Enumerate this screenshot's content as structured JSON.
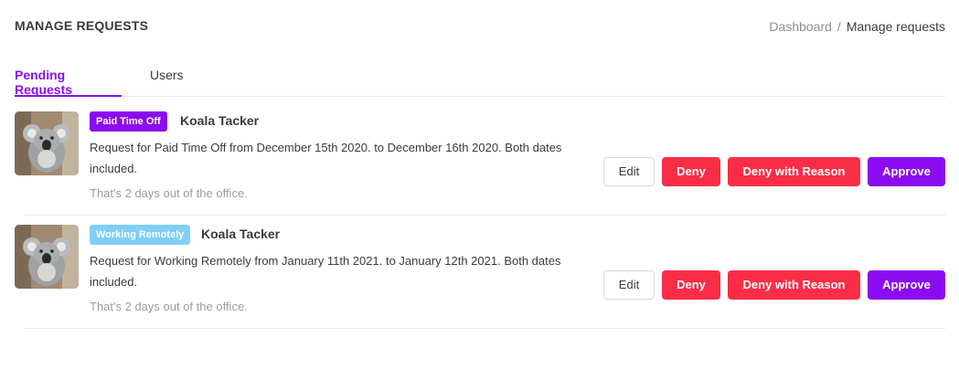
{
  "header": {
    "title": "MANAGE REQUESTS",
    "breadcrumb": {
      "link": "Dashboard",
      "separator": "/",
      "current": "Manage requests"
    }
  },
  "tabs": [
    {
      "label": "Pending Requests",
      "active": true
    },
    {
      "label": "Users",
      "active": false
    }
  ],
  "requests": [
    {
      "badge": "Paid Time Off",
      "badge_color": "#8b0cf0",
      "name": "Koala Tacker",
      "description": "Request for Paid Time Off from December 15th 2020. to December 16th 2020. Both dates included.",
      "summary": "That's 2 days out of the office.",
      "buttons": {
        "edit": "Edit",
        "deny": "Deny",
        "deny_reason": "Deny with Reason",
        "approve": "Approve"
      }
    },
    {
      "badge": "Working Remotely",
      "badge_color": "#7fcff6",
      "name": "Koala Tacker",
      "description": "Request for Working Remotely from January 11th 2021. to January 12th 2021. Both dates included.",
      "summary": "That's 2 days out of the office.",
      "buttons": {
        "edit": "Edit",
        "deny": "Deny",
        "deny_reason": "Deny with Reason",
        "approve": "Approve"
      }
    }
  ],
  "colors": {
    "accent": "#8b0cf0",
    "danger": "#fb2d46",
    "info": "#7fcff6"
  }
}
